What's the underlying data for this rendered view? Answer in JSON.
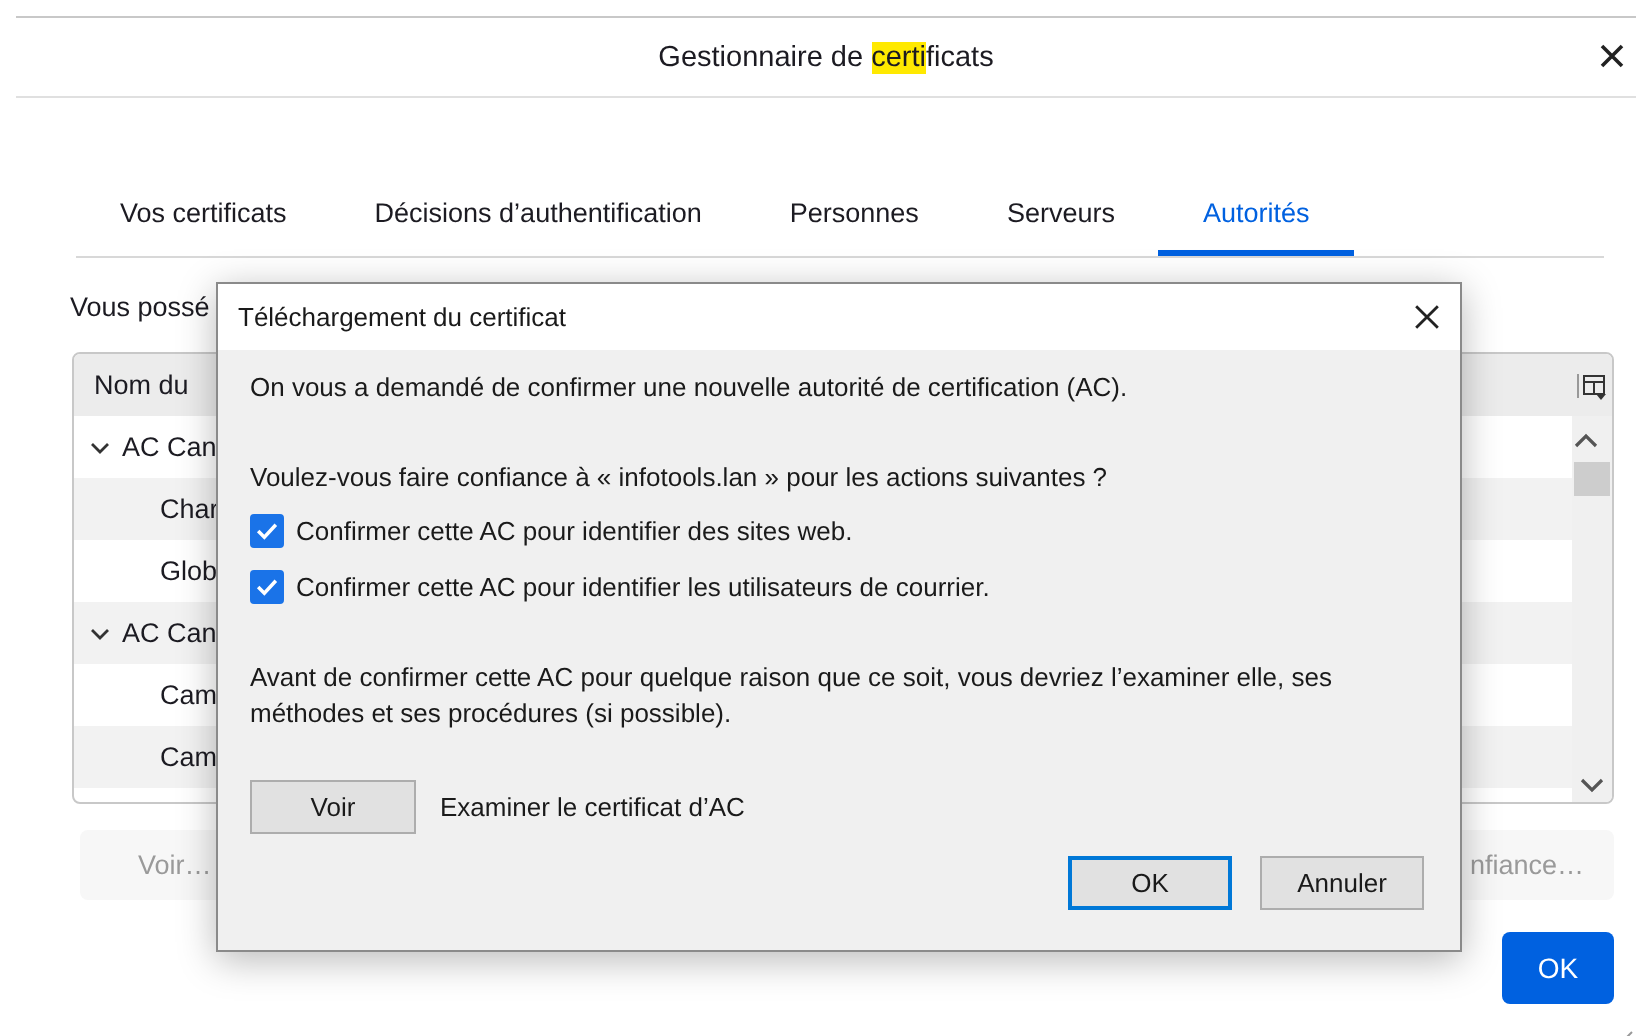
{
  "window": {
    "title": [
      {
        "text": "Gestionnaire de ",
        "highlighted": false
      },
      {
        "text": "certi",
        "highlighted": true
      },
      {
        "text": "ficats",
        "highlighted": false
      }
    ]
  },
  "tabs": [
    {
      "label": "Vos certificats",
      "selected": false
    },
    {
      "label": "Décisions d’authentification",
      "selected": false
    },
    {
      "label": "Personnes",
      "selected": false
    },
    {
      "label": "Serveurs",
      "selected": false
    },
    {
      "label": "Autorités",
      "selected": true
    }
  ],
  "intro": "Vous possé",
  "table": {
    "column_1": "Nom du",
    "rows": [
      {
        "label": "AC Can",
        "expanded": true,
        "children": [
          {
            "label": "Char"
          },
          {
            "label": "Glob"
          }
        ]
      },
      {
        "label": "AC Can",
        "expanded": true,
        "children": [
          {
            "label": "Cam"
          },
          {
            "label": "Cam"
          }
        ]
      }
    ]
  },
  "buttons": [
    {
      "label": "Voir…",
      "disabled": true
    },
    {
      "label": "nfiance…",
      "disabled": true
    }
  ],
  "ok_button": "OK",
  "dialog": {
    "title": "Téléchargement du certificat",
    "message": "On vous a demandé de confirmer une nouvelle autorité de certification (AC).",
    "question": "Voulez-vous faire confiance à « infotools.lan » pour les actions suivantes ?",
    "options": [
      {
        "label": "Confirmer cette AC pour identifier des sites web.",
        "checked": true
      },
      {
        "label": "Confirmer cette AC pour identifier les utilisateurs de courrier.",
        "checked": true
      }
    ],
    "warning": "Avant de confirmer cette AC pour quelque raison que ce soit, vous devriez l’examiner elle, ses méthodes et ses procédures (si possible).",
    "view_button": "Voir",
    "view_label": "Examiner le certificat d’AC",
    "buttons": [
      {
        "label": "OK",
        "default": true
      },
      {
        "label": "Annuler",
        "default": false
      }
    ]
  }
}
